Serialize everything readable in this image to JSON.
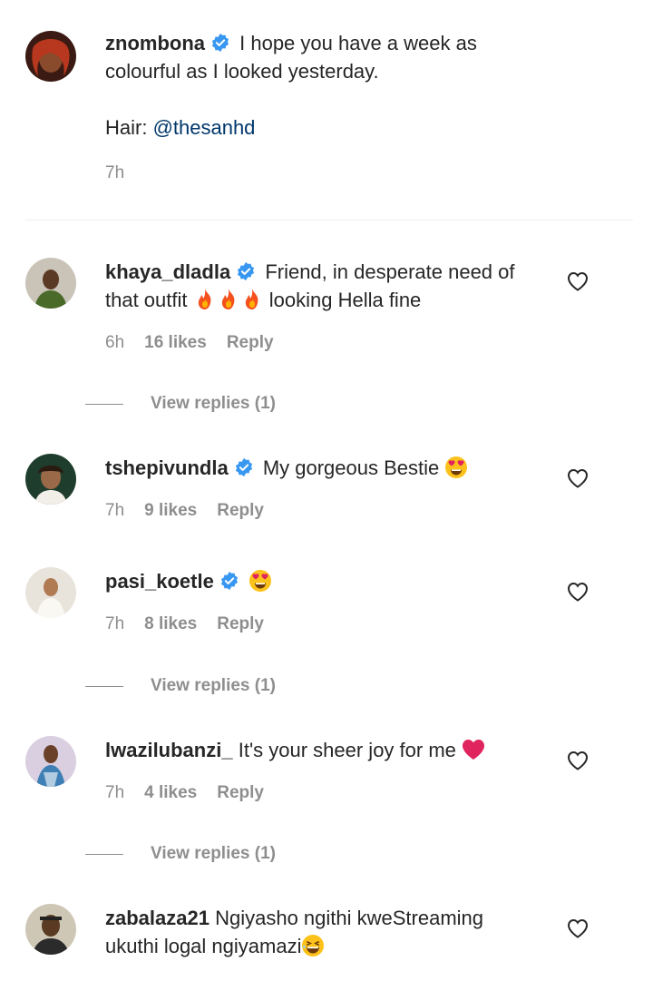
{
  "caption": {
    "username": "znombona",
    "text_line1": "I hope you have a week as",
    "text_line2": "colourful as I looked yesterday.",
    "hair_prefix": "Hair: ",
    "hair_mention": "@thesanhd",
    "time": "7h"
  },
  "comments": [
    {
      "username": "khaya_dladla",
      "text_a": "Friend, in desperate need of",
      "text_b": "that outfit ",
      "text_c": " looking Hella fine",
      "time": "6h",
      "likes": "16 likes",
      "reply": "Reply",
      "view_replies": "View replies (1)"
    },
    {
      "username": "tshepivundla",
      "text_a": "My gorgeous Bestie ",
      "time": "7h",
      "likes": "9 likes",
      "reply": "Reply"
    },
    {
      "username": "pasi_koetle",
      "time": "7h",
      "likes": "8 likes",
      "reply": "Reply",
      "view_replies": "View replies (1)"
    },
    {
      "username": "lwazilubanzi_",
      "text_a": "It's your sheer joy for me ",
      "time": "7h",
      "likes": "4 likes",
      "reply": "Reply",
      "view_replies": "View replies (1)"
    },
    {
      "username": "zabalaza21",
      "text_a": "Ngiyasho ngithi kweStreaming",
      "text_b": "ukuthi logal ngiyamazi"
    }
  ],
  "colors": {
    "verified": "#3897f0",
    "mention": "#00376b",
    "muted": "#8e8e8e"
  }
}
